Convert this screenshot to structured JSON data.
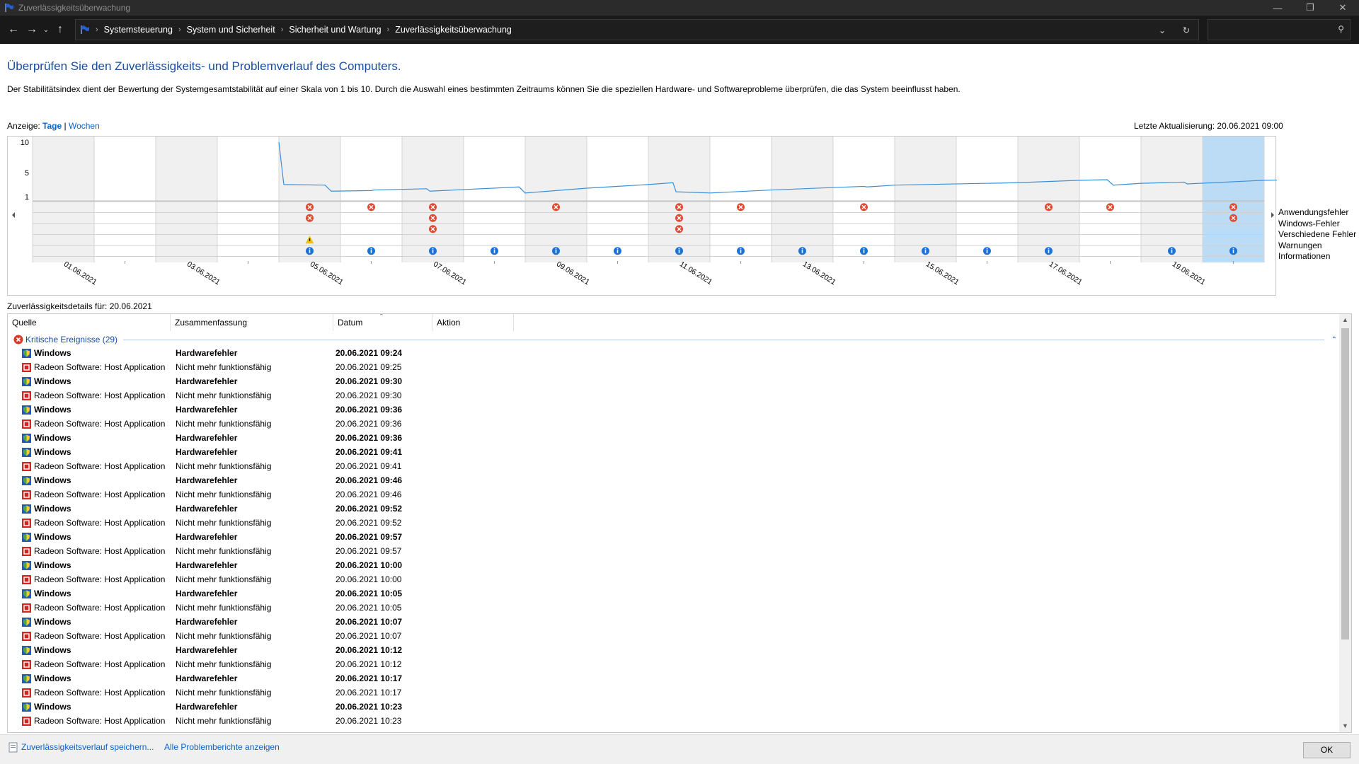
{
  "window": {
    "title": "Zuverlässigkeitsüberwachung"
  },
  "nav": {
    "breadcrumbs": [
      "Systemsteuerung",
      "System und Sicherheit",
      "Sicherheit und Wartung",
      "Zuverlässigkeitsüberwachung"
    ]
  },
  "page": {
    "heading": "Überprüfen Sie den Zuverlässigkeits- und Problemverlauf des Computers.",
    "description": "Der Stabilitätsindex dient der Bewertung der Systemgesamtstabilität auf einer Skala von 1 bis 10. Durch die Auswahl eines bestimmten Zeitraums können Sie die speziellen Hardware- und Softwareprobleme überprüfen, die das System beeinflusst haben.",
    "view_label": "Anzeige:",
    "view_days": "Tage",
    "view_weeks": "Wochen",
    "last_update": "Letzte Aktualisierung: 20.06.2021 09:00",
    "details_label": "Zuverlässigkeitsdetails für: 20.06.2021"
  },
  "legend": [
    "Anwendungsfehler",
    "Windows-Fehler",
    "Verschiedene Fehler",
    "Warnungen",
    "Informationen"
  ],
  "chart_data": {
    "type": "line",
    "y_ticks": [
      "10",
      "5",
      "1"
    ],
    "ylim": [
      1,
      10
    ],
    "x_tick_labels": [
      "01.06.2021",
      "03.06.2021",
      "05.06.2021",
      "07.06.2021",
      "09.06.2021",
      "11.06.2021",
      "13.06.2021",
      "15.06.2021",
      "17.06.2021",
      "19.06.2021"
    ],
    "days": 20,
    "selected_day": "20.06.2021",
    "stability_index": [
      [
        4.0,
        10.0
      ],
      [
        4.08,
        3.0
      ],
      [
        4.75,
        2.9
      ],
      [
        4.85,
        1.9
      ],
      [
        5.5,
        2.0
      ],
      [
        5.55,
        2.1
      ],
      [
        6.4,
        2.3
      ],
      [
        6.45,
        1.9
      ],
      [
        7.9,
        2.6
      ],
      [
        8.0,
        1.6
      ],
      [
        9.0,
        2.4
      ],
      [
        10.0,
        3.0
      ],
      [
        10.4,
        3.3
      ],
      [
        10.45,
        1.8
      ],
      [
        11.0,
        1.6
      ],
      [
        12.0,
        2.1
      ],
      [
        13.5,
        2.7
      ],
      [
        13.55,
        2.6
      ],
      [
        14.0,
        2.9
      ],
      [
        16.0,
        3.3
      ],
      [
        17.0,
        3.7
      ],
      [
        17.45,
        3.8
      ],
      [
        17.55,
        2.9
      ],
      [
        18.0,
        3.2
      ],
      [
        18.7,
        3.4
      ],
      [
        18.75,
        3.1
      ],
      [
        20.0,
        3.7
      ],
      [
        20.6,
        3.8
      ],
      [
        20.95,
        1.9
      ]
    ],
    "events": {
      "app_errors": [
        5,
        6,
        7,
        9,
        11,
        12,
        14,
        17,
        18,
        20
      ],
      "windows_errors": [
        5,
        7,
        11,
        20
      ],
      "misc_errors": [
        7,
        11
      ],
      "warnings": [
        5
      ],
      "info": [
        5,
        6,
        7,
        8,
        9,
        10,
        11,
        12,
        13,
        14,
        15,
        16,
        17,
        19,
        20
      ]
    }
  },
  "table": {
    "columns": [
      "Quelle",
      "Zusammenfassung",
      "Datum",
      "Aktion"
    ],
    "group_label": "Kritische Ereignisse (29)",
    "rows": [
      {
        "source": "Windows",
        "summary": "Hardwarefehler",
        "date": "20.06.2021 09:24",
        "kind": "win"
      },
      {
        "source": "Radeon Software: Host Application",
        "summary": "Nicht mehr funktionsfähig",
        "date": "20.06.2021 09:25",
        "kind": "app"
      },
      {
        "source": "Windows",
        "summary": "Hardwarefehler",
        "date": "20.06.2021 09:30",
        "kind": "win"
      },
      {
        "source": "Radeon Software: Host Application",
        "summary": "Nicht mehr funktionsfähig",
        "date": "20.06.2021 09:30",
        "kind": "app"
      },
      {
        "source": "Windows",
        "summary": "Hardwarefehler",
        "date": "20.06.2021 09:36",
        "kind": "win"
      },
      {
        "source": "Radeon Software: Host Application",
        "summary": "Nicht mehr funktionsfähig",
        "date": "20.06.2021 09:36",
        "kind": "app"
      },
      {
        "source": "Windows",
        "summary": "Hardwarefehler",
        "date": "20.06.2021 09:36",
        "kind": "win"
      },
      {
        "source": "Windows",
        "summary": "Hardwarefehler",
        "date": "20.06.2021 09:41",
        "kind": "win"
      },
      {
        "source": "Radeon Software: Host Application",
        "summary": "Nicht mehr funktionsfähig",
        "date": "20.06.2021 09:41",
        "kind": "app"
      },
      {
        "source": "Windows",
        "summary": "Hardwarefehler",
        "date": "20.06.2021 09:46",
        "kind": "win"
      },
      {
        "source": "Radeon Software: Host Application",
        "summary": "Nicht mehr funktionsfähig",
        "date": "20.06.2021 09:46",
        "kind": "app"
      },
      {
        "source": "Windows",
        "summary": "Hardwarefehler",
        "date": "20.06.2021 09:52",
        "kind": "win"
      },
      {
        "source": "Radeon Software: Host Application",
        "summary": "Nicht mehr funktionsfähig",
        "date": "20.06.2021 09:52",
        "kind": "app"
      },
      {
        "source": "Windows",
        "summary": "Hardwarefehler",
        "date": "20.06.2021 09:57",
        "kind": "win"
      },
      {
        "source": "Radeon Software: Host Application",
        "summary": "Nicht mehr funktionsfähig",
        "date": "20.06.2021 09:57",
        "kind": "app"
      },
      {
        "source": "Windows",
        "summary": "Hardwarefehler",
        "date": "20.06.2021 10:00",
        "kind": "win"
      },
      {
        "source": "Radeon Software: Host Application",
        "summary": "Nicht mehr funktionsfähig",
        "date": "20.06.2021 10:00",
        "kind": "app"
      },
      {
        "source": "Windows",
        "summary": "Hardwarefehler",
        "date": "20.06.2021 10:05",
        "kind": "win"
      },
      {
        "source": "Radeon Software: Host Application",
        "summary": "Nicht mehr funktionsfähig",
        "date": "20.06.2021 10:05",
        "kind": "app"
      },
      {
        "source": "Windows",
        "summary": "Hardwarefehler",
        "date": "20.06.2021 10:07",
        "kind": "win"
      },
      {
        "source": "Radeon Software: Host Application",
        "summary": "Nicht mehr funktionsfähig",
        "date": "20.06.2021 10:07",
        "kind": "app"
      },
      {
        "source": "Windows",
        "summary": "Hardwarefehler",
        "date": "20.06.2021 10:12",
        "kind": "win"
      },
      {
        "source": "Radeon Software: Host Application",
        "summary": "Nicht mehr funktionsfähig",
        "date": "20.06.2021 10:12",
        "kind": "app"
      },
      {
        "source": "Windows",
        "summary": "Hardwarefehler",
        "date": "20.06.2021 10:17",
        "kind": "win"
      },
      {
        "source": "Radeon Software: Host Application",
        "summary": "Nicht mehr funktionsfähig",
        "date": "20.06.2021 10:17",
        "kind": "app"
      },
      {
        "source": "Windows",
        "summary": "Hardwarefehler",
        "date": "20.06.2021 10:23",
        "kind": "win"
      },
      {
        "source": "Radeon Software: Host Application",
        "summary": "Nicht mehr funktionsfähig",
        "date": "20.06.2021 10:23",
        "kind": "app"
      }
    ]
  },
  "footer": {
    "save_link": "Zuverlässigkeitsverlauf speichern...",
    "reports_link": "Alle Problemberichte anzeigen",
    "ok": "OK"
  },
  "colors": {
    "accent": "#1a4da0",
    "link": "#0a63c9",
    "selection": "#bcdcf5",
    "line": "#3a8fd9",
    "error": "#e04a32",
    "info": "#1a73d9",
    "warning": "#f2c200"
  }
}
